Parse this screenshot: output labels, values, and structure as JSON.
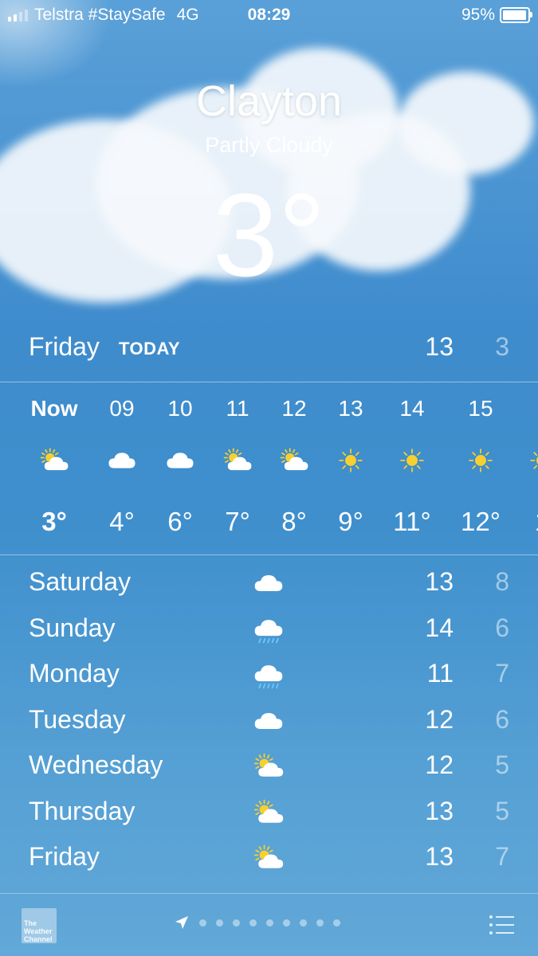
{
  "status": {
    "carrier": "Telstra #StaySafe",
    "network": "4G",
    "time": "08:29",
    "battery": "95%",
    "battery_level": 0.95,
    "signal_bars": 2
  },
  "location": {
    "city": "Clayton",
    "condition": "Partly Cloudy",
    "temperature": "3°"
  },
  "today": {
    "day": "Friday",
    "tag": "TODAY",
    "high": "13",
    "low": "3"
  },
  "hourly": [
    {
      "time": "Now",
      "icon": "partly-cloudy-icon",
      "temp": "3°"
    },
    {
      "time": "09",
      "icon": "cloud-icon",
      "temp": "4°"
    },
    {
      "time": "10",
      "icon": "cloud-icon",
      "temp": "6°"
    },
    {
      "time": "11",
      "icon": "partly-cloudy-icon",
      "temp": "7°"
    },
    {
      "time": "12",
      "icon": "partly-cloudy-icon",
      "temp": "8°"
    },
    {
      "time": "13",
      "icon": "sun-icon",
      "temp": "9°"
    },
    {
      "time": "14",
      "icon": "sun-icon",
      "temp": "11°"
    },
    {
      "time": "15",
      "icon": "sun-icon",
      "temp": "12°"
    },
    {
      "time": "",
      "icon": "sun-icon",
      "temp": "1"
    }
  ],
  "daily": [
    {
      "day": "Saturday",
      "icon": "cloud-icon",
      "high": "13",
      "low": "8"
    },
    {
      "day": "Sunday",
      "icon": "rain-icon",
      "high": "14",
      "low": "6"
    },
    {
      "day": "Monday",
      "icon": "rain-icon",
      "high": "11",
      "low": "7"
    },
    {
      "day": "Tuesday",
      "icon": "cloud-icon",
      "high": "12",
      "low": "6"
    },
    {
      "day": "Wednesday",
      "icon": "partly-cloudy-icon",
      "high": "12",
      "low": "5"
    },
    {
      "day": "Thursday",
      "icon": "partly-cloudy-icon",
      "high": "13",
      "low": "5"
    },
    {
      "day": "Friday",
      "icon": "partly-cloudy-icon",
      "high": "13",
      "low": "7"
    }
  ],
  "toolbar": {
    "logo_text": "The Weather Channel",
    "page_count": 10,
    "active_page": 0
  },
  "colors": {
    "sun": "#f7cf2f",
    "rain": "#6ec6ff",
    "cloud": "#ffffff"
  }
}
